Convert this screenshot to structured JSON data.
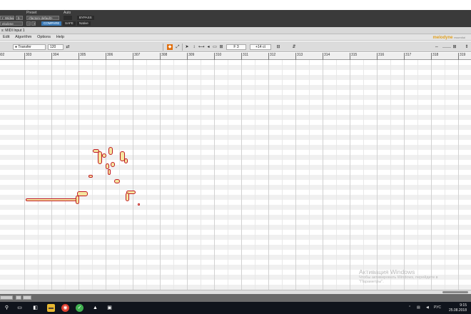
{
  "plugin_header": {
    "preset_label": "Preset",
    "auto_label": "Auto",
    "track_name": "r_Widwell",
    "track_letter": "b",
    "plugin_name": "elodyne",
    "preset_value": "<factory default>",
    "compare_label": "COMPARE",
    "safe_label": "SAFE",
    "bypass_label": "BYPASS",
    "native_label": "Native",
    "minus_label": "-",
    "plus_label": "+"
  },
  "window": {
    "title": "s: MIDI Input 1"
  },
  "menu": {
    "items": [
      "Edit",
      "Algorithm",
      "Options",
      "Help"
    ],
    "brand": "melodyne",
    "brand_suffix": "essential"
  },
  "toolbar": {
    "transfer_label": "Transfer",
    "tempo_value": "120",
    "pitch_field": "F 3",
    "cents_field": "+14 ct"
  },
  "ruler": {
    "ticks": [
      "302",
      "303",
      "304",
      "305",
      "306",
      "307",
      "308",
      "309",
      "310",
      "311",
      "312",
      "313",
      "314",
      "315",
      "316",
      "317",
      "318",
      "319"
    ]
  },
  "watermark": {
    "title": "Активация Windows",
    "line1": "Чтобы активировать Windows, перейдите в",
    "line2": "\"Параметры\"."
  },
  "taskbar": {
    "lang": "РУС",
    "time": "9:15",
    "date": "25.08.2018"
  },
  "colors": {
    "blob_border": "#c01820",
    "blob_fill": "#f5e6a0",
    "accent_blue": "#3a7ab8"
  }
}
